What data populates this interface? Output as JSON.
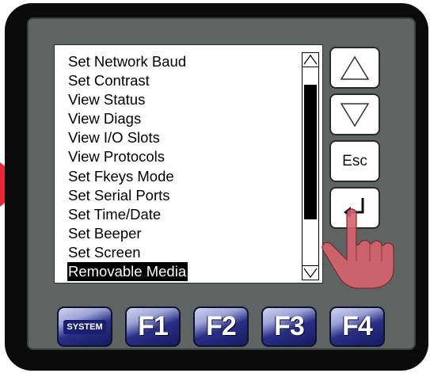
{
  "screen": {
    "menu_items": [
      "Set Network Baud",
      "Set Contrast",
      "View Status",
      "View Diags",
      "View I/O Slots",
      "View Protocols",
      "Set Fkeys Mode",
      "Set Serial Ports",
      "Set Time/Date",
      "Set Beeper",
      "Set Screen",
      "Removable Media"
    ],
    "selected_index": 11
  },
  "side_buttons": {
    "esc_label": "Esc"
  },
  "function_keys": {
    "system_label": "SYSTEM",
    "f1_label": "F1",
    "f2_label": "F2",
    "f3_label": "F3",
    "f4_label": "F4"
  },
  "colors": {
    "bezel": "#0b0b0b",
    "panel": "#5d6461",
    "pointer_arrow": "#e8283a",
    "key_blue": "#1a1f70"
  }
}
